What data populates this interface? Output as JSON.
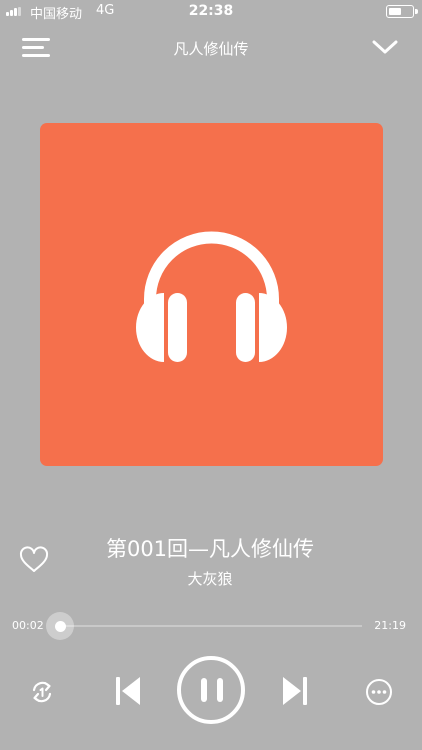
{
  "status_bar": {
    "carrier": "中国移动",
    "network": "4G",
    "time": "22:38",
    "battery_level": 0.55
  },
  "header": {
    "title": "凡人修仙传",
    "menu_icon": "hamburger-menu-icon",
    "collapse_icon": "chevron-down-icon"
  },
  "cover": {
    "background_color": "#f5704c",
    "icon": "headphones-icon"
  },
  "track": {
    "title": "第001回—凡人修仙传",
    "artist": "大灰狼",
    "liked": false
  },
  "progress": {
    "current_time": "00:02",
    "total_time": "21:19",
    "fraction": 0.002
  },
  "controls": {
    "repeat_icon": "repeat-one-icon",
    "prev_icon": "skip-previous-icon",
    "state": "playing",
    "play_pause_icon": "pause-icon",
    "next_icon": "skip-next-icon",
    "more_icon": "more-horizontal-icon"
  },
  "colors": {
    "background": "#b2b2b2",
    "accent": "#f5704c",
    "foreground": "#ffffff"
  }
}
